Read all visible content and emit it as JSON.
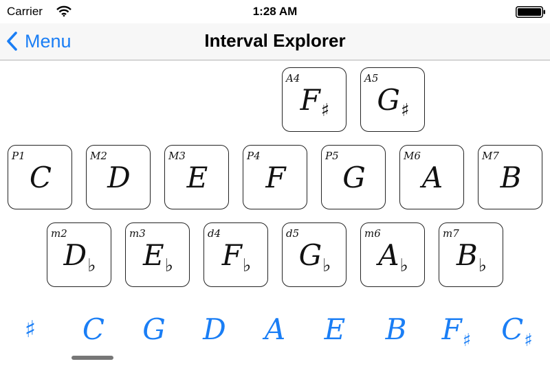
{
  "status_bar": {
    "carrier": "Carrier",
    "time": "1:28 AM"
  },
  "nav": {
    "back_label": "Menu",
    "title": "Interval Explorer"
  },
  "keys": {
    "row1": [
      {
        "interval": "A4",
        "note": "F",
        "accidental": "♯"
      },
      {
        "interval": "A5",
        "note": "G",
        "accidental": "♯"
      }
    ],
    "row2": [
      {
        "interval": "P1",
        "note": "C",
        "accidental": ""
      },
      {
        "interval": "M2",
        "note": "D",
        "accidental": ""
      },
      {
        "interval": "M3",
        "note": "E",
        "accidental": ""
      },
      {
        "interval": "P4",
        "note": "F",
        "accidental": ""
      },
      {
        "interval": "P5",
        "note": "G",
        "accidental": ""
      },
      {
        "interval": "M6",
        "note": "A",
        "accidental": ""
      },
      {
        "interval": "M7",
        "note": "B",
        "accidental": ""
      }
    ],
    "row3": [
      {
        "interval": "m2",
        "note": "D",
        "accidental": "♭"
      },
      {
        "interval": "m3",
        "note": "E",
        "accidental": "♭"
      },
      {
        "interval": "d4",
        "note": "F",
        "accidental": "♭"
      },
      {
        "interval": "d5",
        "note": "G",
        "accidental": "♭"
      },
      {
        "interval": "m6",
        "note": "A",
        "accidental": "♭"
      },
      {
        "interval": "m7",
        "note": "B",
        "accidental": "♭"
      }
    ]
  },
  "key_selector": {
    "toggle": "♯",
    "keys": [
      {
        "note": "C",
        "accidental": ""
      },
      {
        "note": "G",
        "accidental": ""
      },
      {
        "note": "D",
        "accidental": ""
      },
      {
        "note": "A",
        "accidental": ""
      },
      {
        "note": "E",
        "accidental": ""
      },
      {
        "note": "B",
        "accidental": ""
      },
      {
        "note": "F",
        "accidental": "♯"
      },
      {
        "note": "C",
        "accidental": "♯"
      }
    ],
    "selected_index": 0
  },
  "colors": {
    "accent": "#1a7ef5",
    "key_border": "#222222"
  }
}
